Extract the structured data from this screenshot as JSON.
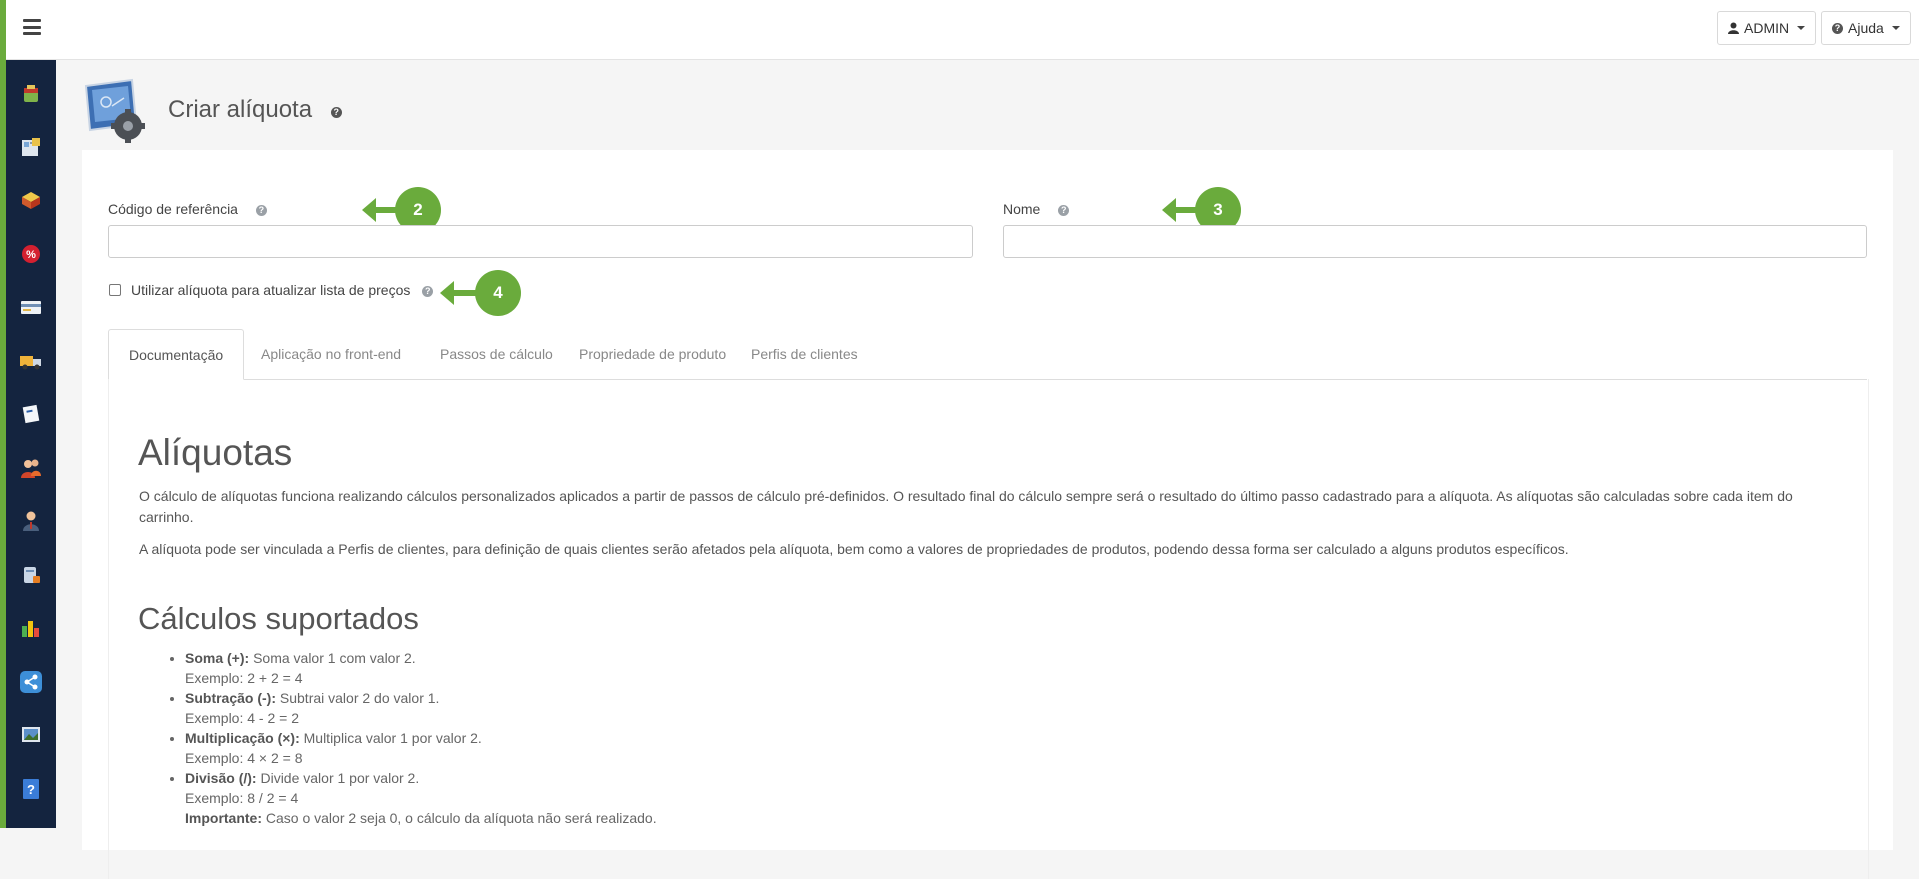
{
  "topbar": {
    "admin_label": "ADMIN",
    "help_label": "Ajuda"
  },
  "page": {
    "title": "Criar alíquota"
  },
  "form": {
    "codigo_label": "Código de referência",
    "nome_label": "Nome",
    "checkbox_label": "Utilizar alíquota para atualizar lista de preços",
    "codigo_value": "",
    "nome_value": ""
  },
  "callouts": [
    "2",
    "3",
    "4"
  ],
  "tabs": [
    {
      "label": "Documentação",
      "active": true
    },
    {
      "label": "Aplicação no front-end",
      "active": false
    },
    {
      "label": "Passos de cálculo",
      "active": false
    },
    {
      "label": "Propriedade de produto",
      "active": false
    },
    {
      "label": "Perfis de clientes",
      "active": false
    }
  ],
  "doc": {
    "heading": "Alíquotas",
    "para1": "O cálculo de alíquotas funciona realizando cálculos personalizados aplicados a partir de passos de cálculo pré-definidos. O resultado final do cálculo sempre será o resultado do último passo cadastrado para a alíquota. As alíquotas são calculadas sobre cada item do carrinho.",
    "para2": "A alíquota pode ser vinculada a Perfis de clientes, para definição de quais clientes serão afetados pela alíquota, bem como a valores de propriedades de produtos, podendo dessa forma ser calculado a alguns produtos específicos.",
    "heading2": "Cálculos suportados",
    "calcs": [
      {
        "name": "Soma (+):",
        "desc": "Soma valor 1 com valor 2.",
        "example": "Exemplo: 2 + 2 = 4"
      },
      {
        "name": "Subtração (-):",
        "desc": "Subtrai valor 2 do valor 1.",
        "example": "Exemplo: 4 - 2 = 2"
      },
      {
        "name": "Multiplicação (×):",
        "desc": "Multiplica valor 1 por valor 2.",
        "example": "Exemplo: 4 × 2 = 8"
      },
      {
        "name": "Divisão (/):",
        "desc": "Divide valor 1 por valor 2.",
        "example": "Exemplo: 8 / 2 = 4",
        "note_label": "Importante:",
        "note": "Caso o valor 2 seja 0, o cálculo da alíquota não será realizado."
      }
    ]
  },
  "colors": {
    "accent_green": "#6aab3c",
    "sidebar_bg": "#14243f"
  },
  "sidebar_icons": [
    "product-box-icon",
    "catalog-icon",
    "packages-icon",
    "discount-icon",
    "payment-card-icon",
    "shipping-truck-icon",
    "note-icon",
    "customers-icon",
    "user-icon",
    "database-icon",
    "reports-chart-icon",
    "share-icon",
    "image-gallery-icon",
    "help-document-icon"
  ]
}
